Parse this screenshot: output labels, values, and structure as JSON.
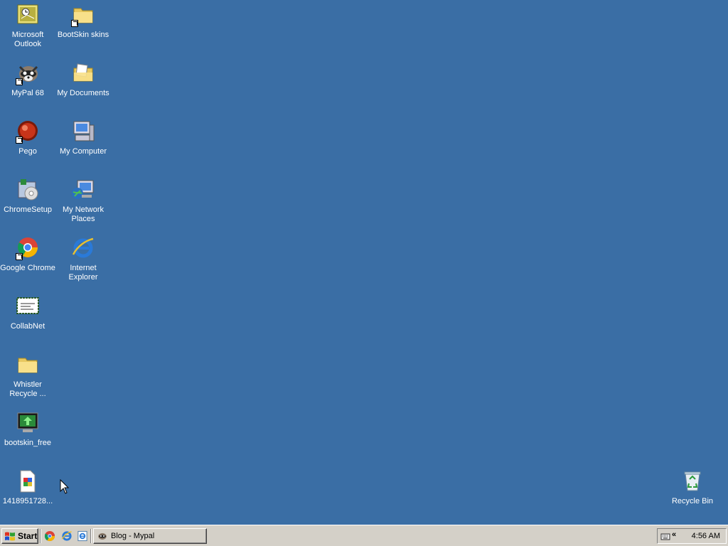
{
  "desktop": {
    "background": "#3a6ea5",
    "icons": {
      "outlook": {
        "label_1": "Microsoft",
        "label_2": "Outlook",
        "icon": "outlook-icon"
      },
      "bootskin_skins": {
        "label": "BootSkin skins",
        "icon": "folder-icon",
        "shortcut": true
      },
      "mypal": {
        "label": "MyPal 68",
        "icon": "raccoon-icon",
        "shortcut": true
      },
      "my_documents": {
        "label": "My Documents",
        "icon": "documents-folder-icon"
      },
      "pego": {
        "label": "Pego",
        "icon": "pego-icon",
        "shortcut": true
      },
      "my_computer": {
        "label": "My Computer",
        "icon": "computer-icon"
      },
      "chrome_setup": {
        "label": "ChromeSetup",
        "icon": "installer-icon"
      },
      "network": {
        "label_1": "My Network",
        "label_2": "Places",
        "icon": "network-icon"
      },
      "chrome": {
        "label": "Google Chrome",
        "icon": "chrome-icon",
        "shortcut": true
      },
      "ie": {
        "label_1": "Internet",
        "label_2": "Explorer",
        "icon": "ie-icon"
      },
      "collabnet": {
        "label": "CollabNet",
        "icon": "certificate-icon"
      },
      "whistler": {
        "label_1": "Whistler",
        "label_2": "Recycle ...",
        "icon": "folder-icon"
      },
      "bootskin_free": {
        "label": "bootskin_free",
        "icon": "monitor-app-icon"
      },
      "file_1418": {
        "label": "1418951728...",
        "icon": "image-file-icon"
      },
      "recycle_bin": {
        "label": "Recycle Bin",
        "icon": "recycle-bin-icon"
      }
    }
  },
  "taskbar": {
    "start_label": "Start",
    "quick_launch": [
      "chrome-icon",
      "ie-icon",
      "ie-doc-icon"
    ],
    "tasks": [
      {
        "label": "Blog - Mypal",
        "icon": "raccoon-icon"
      }
    ],
    "tray_chevron": "«",
    "clock": "4:56 AM"
  }
}
